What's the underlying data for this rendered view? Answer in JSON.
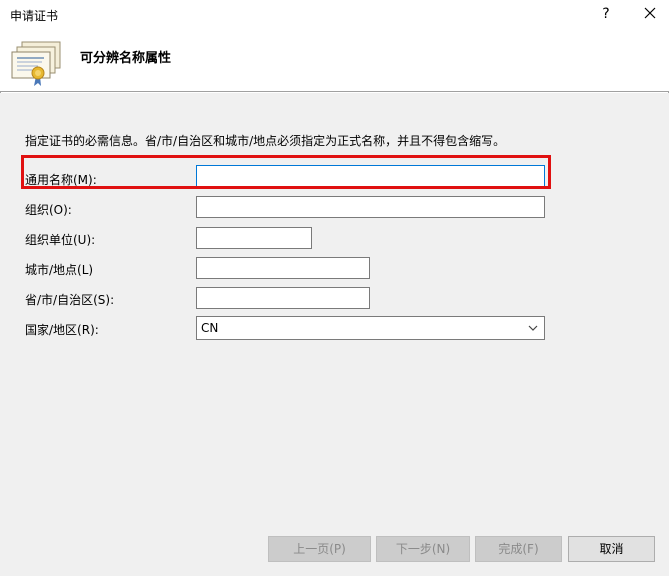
{
  "window": {
    "title": "申请证书",
    "help_label": "?"
  },
  "header": {
    "title": "可分辨名称属性",
    "icon": "certificate-icon"
  },
  "instruction": "指定证书的必需信息。省/市/自治区和城市/地点必须指定为正式名称，并且不得包含缩写。",
  "fields": {
    "common_name": {
      "label": "通用名称(M):",
      "value": ""
    },
    "organization": {
      "label": "组织(O):",
      "value": ""
    },
    "org_unit": {
      "label": "组织单位(U):",
      "value": ""
    },
    "city": {
      "label": "城市/地点(L)",
      "value": ""
    },
    "state": {
      "label": "省/市/自治区(S):",
      "value": ""
    },
    "country": {
      "label": "国家/地区(R):",
      "value": "CN"
    }
  },
  "buttons": {
    "prev": "上一页(P)",
    "next": "下一步(N)",
    "finish": "完成(F)",
    "cancel": "取消"
  },
  "colors": {
    "highlight": "#e01010",
    "focus_border": "#0078d7",
    "panel_bg": "#f0f0f0"
  }
}
